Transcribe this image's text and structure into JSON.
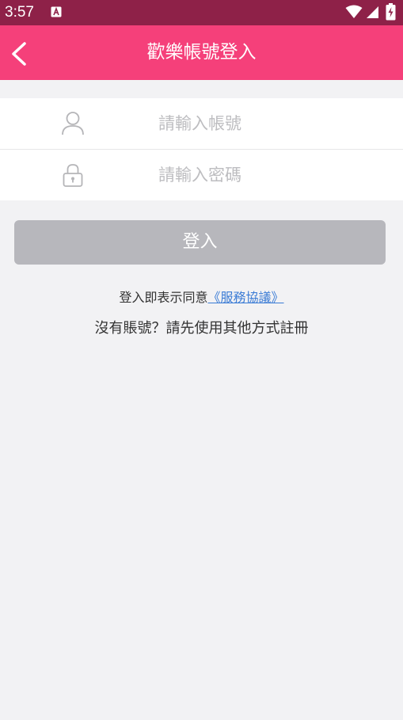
{
  "status_bar": {
    "time": "3:57",
    "notification_icon": "a-notification-icon",
    "wifi_icon": "wifi-icon",
    "signal_icon": "cell-signal-icon",
    "battery_icon": "battery-charging-icon"
  },
  "header": {
    "title": "歡樂帳號登入",
    "back_icon": "chevron-left-icon",
    "background_color": "#f5407a"
  },
  "form": {
    "account": {
      "icon": "user-icon",
      "placeholder": "請輸入帳號",
      "value": ""
    },
    "password": {
      "icon": "lock-icon",
      "placeholder": "請輸入密碼",
      "value": ""
    }
  },
  "login_button": {
    "label": "登入",
    "color": "#b7b7bc"
  },
  "agreement": {
    "prefix": "登入即表示同意",
    "link_text": "《服務協議》",
    "link_color": "#3a7bd5"
  },
  "register_hint": "沒有賬號？請先使用其他方式註冊"
}
